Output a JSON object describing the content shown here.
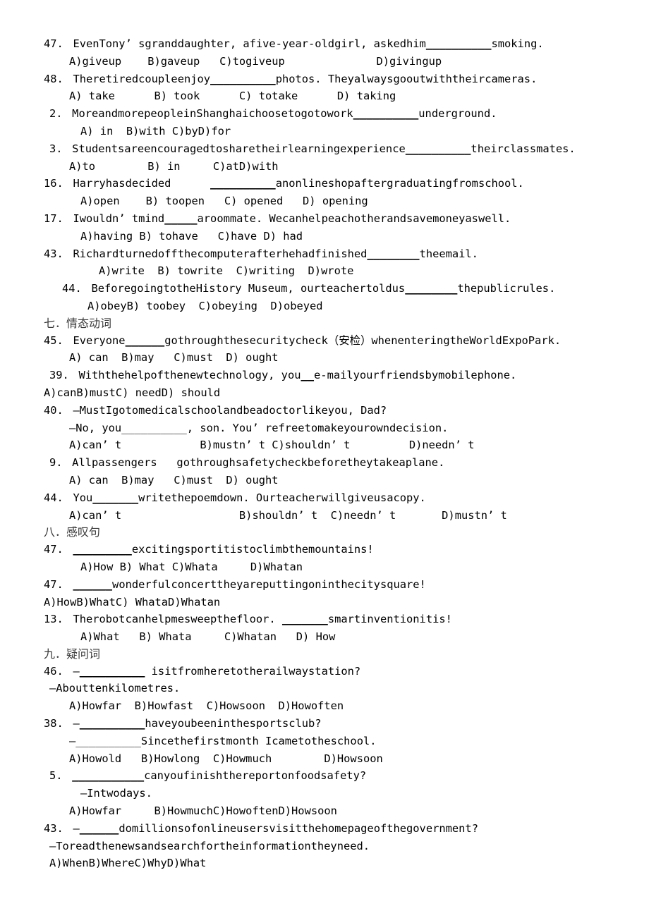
{
  "document": {
    "type": "grammar-exercise-worksheet",
    "language": "en-zh",
    "blocks": [
      {
        "kind": "question",
        "indent": "indent1",
        "number": "47.",
        "stem": "EvenTony’ sgranddaughter, afive-year-oldgirl, askedhim",
        "blank": "__________",
        "stem_tail": "smoking.",
        "options_indent": "indent3",
        "options": "A)giveup    B)gaveup   C)togiveup              D)givingup"
      },
      {
        "kind": "question",
        "indent": "indent1",
        "number": "48.",
        "stem": "Theretiredcoupleenjoy",
        "blank": "__________",
        "stem_tail": "photos. Theyalwaysgooutwiththeircameras.",
        "options_indent": "indent3",
        "options": "A) take      B) took      C) totake      D) taking"
      },
      {
        "kind": "question",
        "indent": "indent-neg",
        "number": "2.",
        "stem": "MoreandmorepeopleinShanghaichoosetogotowork",
        "blank": "__________",
        "stem_tail": "underground.",
        "options_indent": "indent4",
        "options": "A) in  B)with C)byD)for"
      },
      {
        "kind": "question",
        "indent": "indent-neg",
        "number": "3.",
        "stem": "Studentsareencouragedtosharetheirlearningexperience",
        "blank": "__________",
        "stem_tail": "theirclassmates.",
        "options_indent": "indent3",
        "options": "A)to        B) in     C)atD)with"
      },
      {
        "kind": "question",
        "indent": "indent1",
        "number": "16.",
        "stem": "Harryhasdecided      ",
        "blank": "__________",
        "stem_tail": "anonlineshopaftergraduatingfromschool.",
        "options_indent": "indent4",
        "options": "A)open    B) toopen   C) opened   D) opening"
      },
      {
        "kind": "question",
        "indent": "indent1",
        "number": "17.",
        "stem": "Iwouldn’ tmind",
        "blank": "_____",
        "stem_tail": "aroommate. Wecanhelpeachotherandsavemoneyaswell.",
        "options_indent": "indent4",
        "options": "A)having B) tohave   C)have D) had"
      },
      {
        "kind": "question",
        "indent": "indent1",
        "number": "43.",
        "stem": "Richardturnedoffthecomputerafterhehadfinished",
        "blank": "________",
        "stem_tail": "theemail.",
        "options_indent": "indent6",
        "options": "A)write  B) towrite  C)writing  D)wrote"
      },
      {
        "kind": "question",
        "indent": "indent2",
        "number": "44.",
        "stem": "BeforegoingtotheHistory Museum, ourteachertoldus",
        "blank": "________",
        "stem_tail": "thepublicrules.",
        "options_indent": "indent5",
        "options": "A)obeyB) toobey  C)obeying  D)obeyed"
      },
      {
        "kind": "section",
        "indent": "indent1",
        "title": "七．情态动词"
      },
      {
        "kind": "question",
        "indent": "indent1",
        "number": "45.",
        "stem": "Everyone",
        "blank": "______",
        "stem_tail": "gothroughthesecuritycheck（安检）whenenteringtheWorldExpoPark.",
        "options_indent": "indent3",
        "options": "A) can  B)may   C)must  D) ought"
      },
      {
        "kind": "question",
        "indent": "indent-neg",
        "number": "39.",
        "stem": "Withthehelpofthenewtechnology, you",
        "blank": "__",
        "stem_tail": "e-mailyourfriendsbymobilephone.",
        "options_indent": "indent1",
        "options": "A)canB)mustC) needD) should"
      },
      {
        "kind": "question",
        "indent": "indent1",
        "number": "40.",
        "stem": "—MustIgotomedicalschoolandbeadoctorlikeyou, Dad?",
        "blank": "",
        "stem_tail": "",
        "cont_indent": "indent3",
        "cont": "—No, you__________, son. You’ refreetomakeyourowndecision.",
        "options_indent": "indent3",
        "options": "A)can’ t            B)mustn’ t C)shouldn’ t         D)needn’ t"
      },
      {
        "kind": "question",
        "indent": "indent-neg",
        "number": "9.",
        "stem": "Allpassengers   gothroughsafetycheckbeforetheytakeaplane.",
        "blank": "",
        "stem_tail": "",
        "options_indent": "indent3",
        "options": "A) can  B)may   C)must  D) ought"
      },
      {
        "kind": "question",
        "indent": "indent1",
        "number": "44.",
        "stem": "You",
        "blank": "_______",
        "stem_tail": "writethepoemdown. Ourteacherwillgiveusacopy.",
        "options_indent": "indent3",
        "options": "A)can’ t                  B)shouldn’ t  C)needn’ t       D)mustn’ t"
      },
      {
        "kind": "section",
        "indent": "indent1",
        "title": "八．感叹句"
      },
      {
        "kind": "question",
        "indent": "indent1",
        "number": "47.",
        "stem": "",
        "blank": "_________",
        "stem_tail": "excitingsportitistoclimbthemountains!",
        "options_indent": "indent4",
        "options": "A)How B) What C)Whata     D)Whatan"
      },
      {
        "kind": "question",
        "indent": "indent1",
        "number": "47.",
        "stem": "",
        "blank": "______",
        "stem_tail": "wonderfulconcerttheyareputtingoninthecitysquare!",
        "options_indent": "indent1",
        "options": "A)HowB)WhatC) WhataD)Whatan"
      },
      {
        "kind": "question",
        "indent": "indent1",
        "number": "13.",
        "stem": "Therobotcanhelpmesweepthefloor. ",
        "blank": "_______",
        "stem_tail": "smartinventionitis!",
        "options_indent": "indent4",
        "options": "A)What   B) Whata     C)Whatan   D) How"
      },
      {
        "kind": "section",
        "indent": "indent1",
        "title": "九．疑问词"
      },
      {
        "kind": "question",
        "indent": "indent1",
        "number": "46.",
        "stem": "—",
        "blank": "__________",
        "stem_tail": " isitfromheretotherailwaystation?",
        "cont_indent": "indent-neg",
        "cont": "—Abouttenkilometres.",
        "options_indent": "indent3",
        "options": "A)Howfar  B)Howfast  C)Howsoon  D)Howoften"
      },
      {
        "kind": "question",
        "indent": "indent1",
        "number": "38.",
        "stem": "—",
        "blank": "__________",
        "stem_tail": "haveyoubeeninthesportsclub?",
        "cont_indent": "indent3",
        "cont": "—__________Sincethefirstmonth Icametotheschool.",
        "options_indent": "indent3",
        "options": "A)Howold   B)Howlong  C)Howmuch        D)Howsoon"
      },
      {
        "kind": "question",
        "indent": "indent-neg",
        "number": "5.",
        "stem": "",
        "blank": "___________",
        "stem_tail": "canyoufinishthereportonfoodsafety?",
        "cont_indent": "indent4",
        "cont": "—Intwodays.",
        "options_indent": "indent3",
        "options": "A)Howfar     B)HowmuchC)HowoftenD)Howsoon"
      },
      {
        "kind": "question",
        "indent": "indent1",
        "number": "43.",
        "stem": "—",
        "blank": "______",
        "stem_tail": "domillionsofonlineusersvisitthehomepageofthegovernment?",
        "cont_indent": "indent-neg",
        "cont": "—Toreadthenewsandsearchfortheinformationtheyneed.",
        "options_indent": "indent-neg",
        "options": "A)WhenB)WhereC)WhyD)What"
      }
    ]
  }
}
